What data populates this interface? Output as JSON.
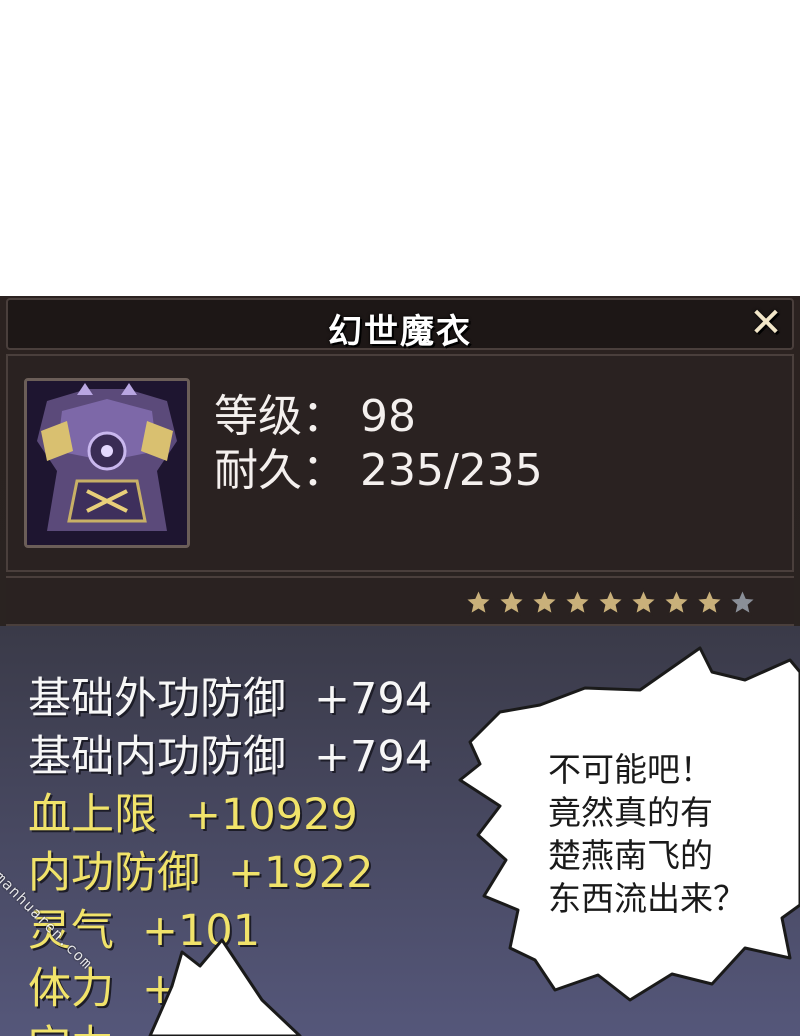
{
  "item_panel": {
    "title": "幻世魔衣",
    "close_label": "✕",
    "level_label": "等级：",
    "level_value": "98",
    "durability_label": "耐久：",
    "durability_value": "235/235",
    "stars": {
      "filled": 8,
      "total": 9,
      "filled_color": "#c9b07a",
      "empty_color": "#8a8f98"
    }
  },
  "attributes": [
    {
      "name": "基础外功防御",
      "value": "+794",
      "color": "white"
    },
    {
      "name": "基础内功防御",
      "value": "+794",
      "color": "white"
    },
    {
      "name": "血上限",
      "value": "+10929",
      "color": "gold"
    },
    {
      "name": "内功防御",
      "value": "+1922",
      "color": "gold"
    },
    {
      "name": "灵气",
      "value": "+101",
      "color": "gold"
    },
    {
      "name": "体力",
      "value": "+",
      "color": "gold"
    },
    {
      "name": "定力",
      "value": "",
      "color": "gold"
    }
  ],
  "speech_bubble": {
    "lines": [
      "不可能吧！",
      "竟然真的有",
      "楚燕南飞的",
      "东西流出来？"
    ]
  },
  "watermark": "manhuaren.com",
  "colors": {
    "panel_dark": "#2a2221",
    "panel_border": "#4a3f3c",
    "attr_white": "#f7f7f7",
    "attr_gold": "#f1e36a"
  }
}
